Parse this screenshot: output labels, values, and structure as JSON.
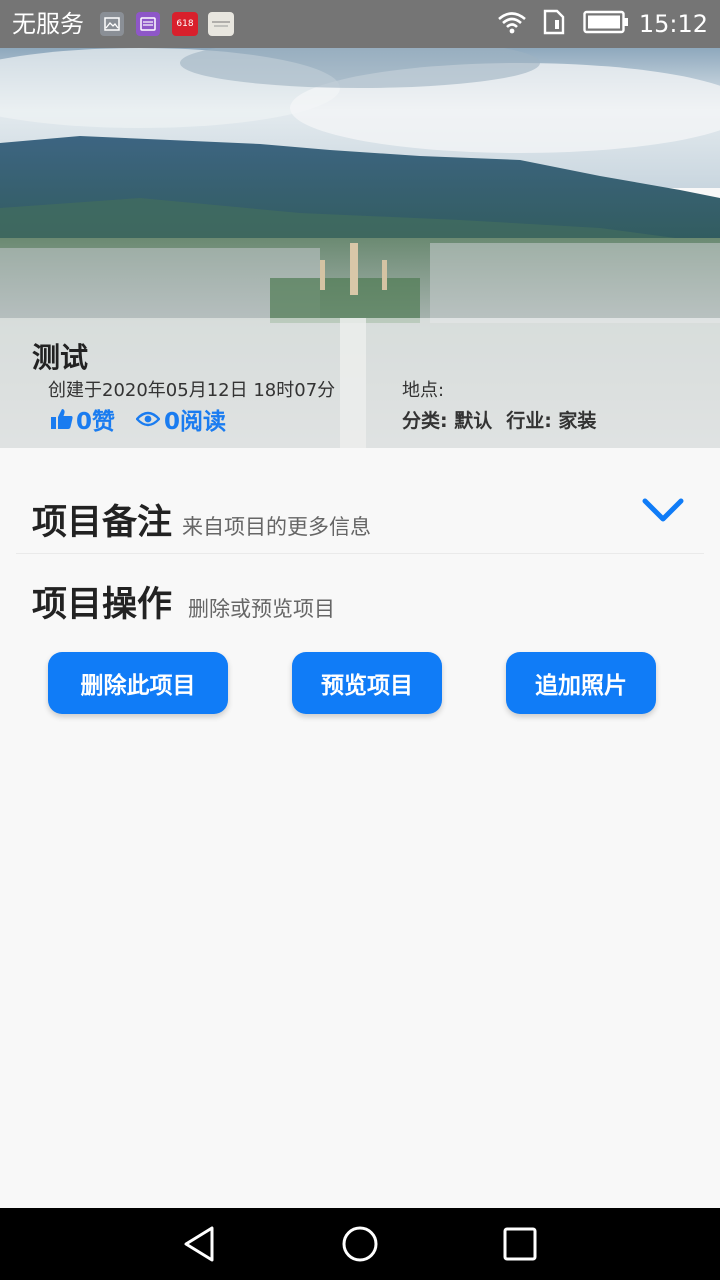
{
  "status_bar": {
    "carrier": "无服务",
    "time": "15:12",
    "notification_icons": [
      "gallery-icon",
      "message-icon",
      "jd-618-icon",
      "app-thumbnail-icon"
    ],
    "jd_badge_text": "618"
  },
  "project": {
    "title": "测试",
    "created": "创建于2020年05月12日 18时07分",
    "likes": "0赞",
    "reads": "0阅读",
    "location_label": "地点:",
    "category": "分类: 默认",
    "industry": "行业:  家装"
  },
  "notes_section": {
    "title": "项目备注",
    "subtitle": "来自项目的更多信息"
  },
  "actions_section": {
    "title": "项目操作",
    "subtitle": "删除或预览项目"
  },
  "buttons": {
    "delete": "删除此项目",
    "preview": "预览项目",
    "add_photo": "追加照片"
  },
  "colors": {
    "accent": "#107cf7",
    "status_bar": "#757575",
    "background": "#f8f8f8"
  }
}
